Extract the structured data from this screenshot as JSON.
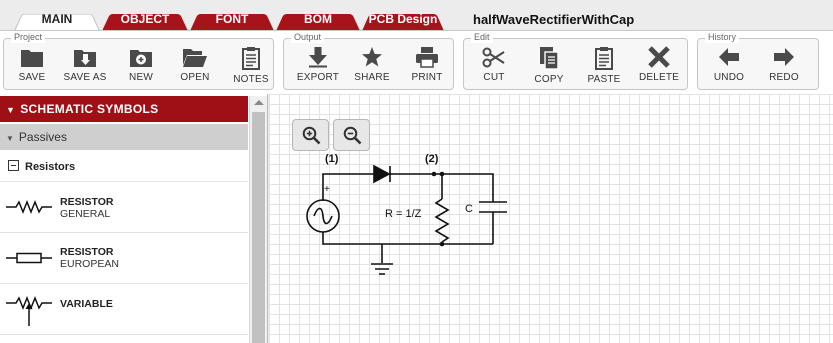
{
  "tabs": [
    {
      "label": "MAIN",
      "active": true
    },
    {
      "label": "OBJECT",
      "active": false
    },
    {
      "label": "FONT",
      "active": false
    },
    {
      "label": "BOM",
      "active": false
    },
    {
      "label": "PCB Design",
      "active": false
    }
  ],
  "document_title": "halfWaveRectifierWithCap",
  "toolbar": {
    "project": {
      "label": "Project",
      "buttons": {
        "save": "SAVE",
        "save_as": "SAVE AS",
        "new": "NEW",
        "open": "OPEN",
        "notes": "NOTES"
      }
    },
    "output": {
      "label": "Output",
      "buttons": {
        "export": "EXPORT",
        "share": "SHARE",
        "print": "PRINT"
      }
    },
    "edit": {
      "label": "Edit",
      "buttons": {
        "cut": "CUT",
        "copy": "COPY",
        "paste": "PASTE",
        "delete": "DELETE"
      }
    },
    "history": {
      "label": "History",
      "buttons": {
        "undo": "UNDO",
        "redo": "REDO"
      }
    }
  },
  "sidebar": {
    "header": "SCHEMATIC SYMBOLS",
    "category": "Passives",
    "subcategory": "Resistors",
    "items": [
      {
        "name": "RESISTOR",
        "sub": "GENERAL"
      },
      {
        "name": "RESISTOR",
        "sub": "EUROPEAN"
      },
      {
        "name": "VARIABLE",
        "sub": ""
      }
    ]
  },
  "canvas": {
    "node_labels": {
      "n1": "(1)",
      "n2": "(2)"
    },
    "resistor_label": "R = 1/Z",
    "capacitor_label": "C",
    "source_polarity": "+"
  },
  "colors": {
    "accent_red": "#a8121a",
    "header_red": "#9f1016",
    "icon_dark": "#4a4a4a"
  }
}
